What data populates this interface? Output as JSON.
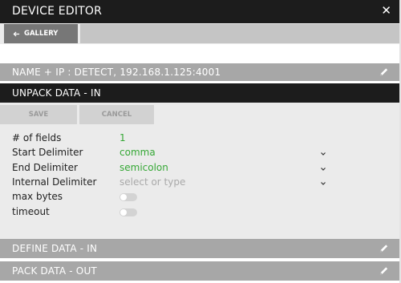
{
  "window": {
    "title": "DEVICE EDITOR",
    "close_icon": "close-icon"
  },
  "nav": {
    "gallery_label": "GALLERY",
    "back_icon": "arrow-left-icon"
  },
  "sections": {
    "name": {
      "label": "NAME + IP : DETECT, 192.168.1.125:4001",
      "edit_icon": "pencil-icon"
    },
    "unpack": {
      "label": "UNPACK DATA - IN",
      "save_label": "SAVE",
      "cancel_label": "CANCEL",
      "fields": {
        "num_fields": {
          "label": "# of fields",
          "value": "1"
        },
        "start_delimiter": {
          "label": "Start Delimiter",
          "value": "comma"
        },
        "end_delimiter": {
          "label": "End Delimiter",
          "value": "semicolon"
        },
        "internal_delimiter": {
          "label": "Internal Delimiter",
          "placeholder": "select or type"
        },
        "max_bytes": {
          "label": "max bytes",
          "enabled": false
        },
        "timeout": {
          "label": "timeout",
          "enabled": false
        }
      }
    },
    "define": {
      "label": "DEFINE DATA - IN",
      "edit_icon": "pencil-icon"
    },
    "pack": {
      "label": "PACK DATA - OUT",
      "edit_icon": "pencil-icon"
    }
  },
  "colors": {
    "titlebar": "#1c1c1c",
    "section_bar": "#a7a7a7",
    "value_green": "#36a836",
    "panel_bg": "#ebebeb"
  }
}
